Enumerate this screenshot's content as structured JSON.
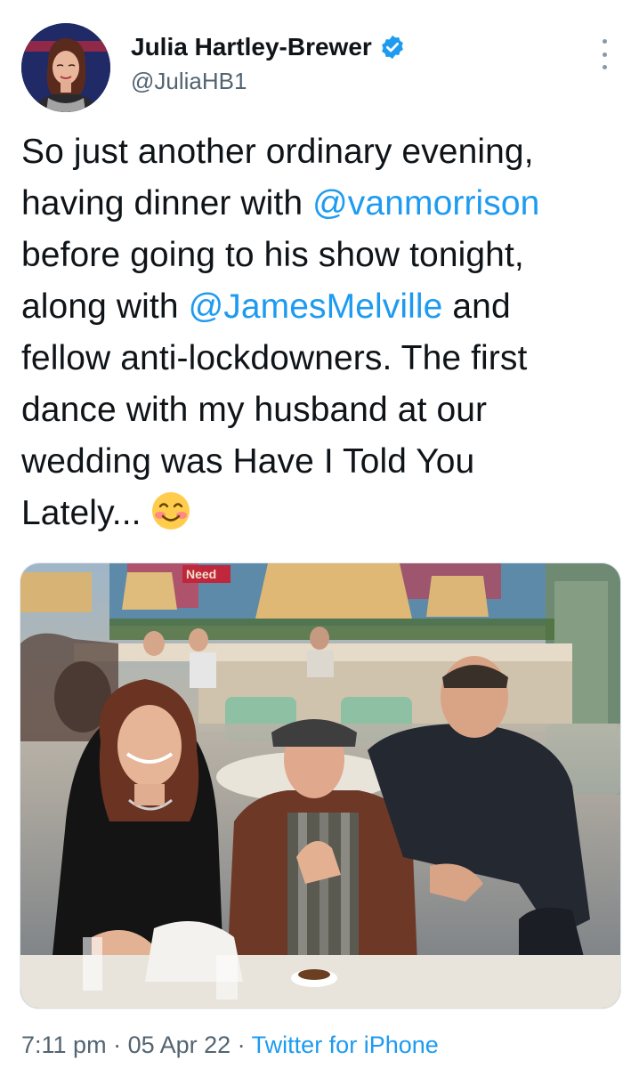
{
  "author": {
    "display_name": "Julia Hartley-Brewer",
    "handle": "@JuliaHB1",
    "avatar_icon": "profile-photo",
    "verified_icon": "verified-badge-icon"
  },
  "tweet": {
    "lines": [
      [
        {
          "t": "So just another ordinary evening,"
        }
      ],
      [
        {
          "t": "having dinner with "
        },
        {
          "m": "@vanmorrison"
        }
      ],
      [
        {
          "t": "before going to his show tonight,"
        }
      ],
      [
        {
          "t": "along with "
        },
        {
          "m": "@JamesMelville"
        },
        {
          "t": " and"
        }
      ],
      [
        {
          "t": "fellow anti-lockdowners. The first"
        }
      ],
      [
        {
          "t": "dance with my husband at our"
        }
      ],
      [
        {
          "t": "wedding was Have I Told You"
        }
      ],
      [
        {
          "t": "Lately..."
        }
      ]
    ],
    "text": "So just another ordinary evening, having dinner with @vanmorrison before going to his show tonight, along with @JamesMelville and fellow anti-lockdowners. The first dance with my husband at our wedding was Have I Told You Lately...",
    "mention_1": "@vanmorrison",
    "mention_2": "@JamesMelville",
    "emoji": "smiling-face-with-blushed-cheeks",
    "media_sign_text": "Need",
    "media_alt": "photo-three-people-at-restaurant-table"
  },
  "meta": {
    "time": "7:11 pm",
    "separator": " · ",
    "date": "05 Apr 22",
    "source": "Twitter for iPhone"
  },
  "colors": {
    "link": "#1d9bf0",
    "secondary": "#536471",
    "text": "#0f1419"
  }
}
